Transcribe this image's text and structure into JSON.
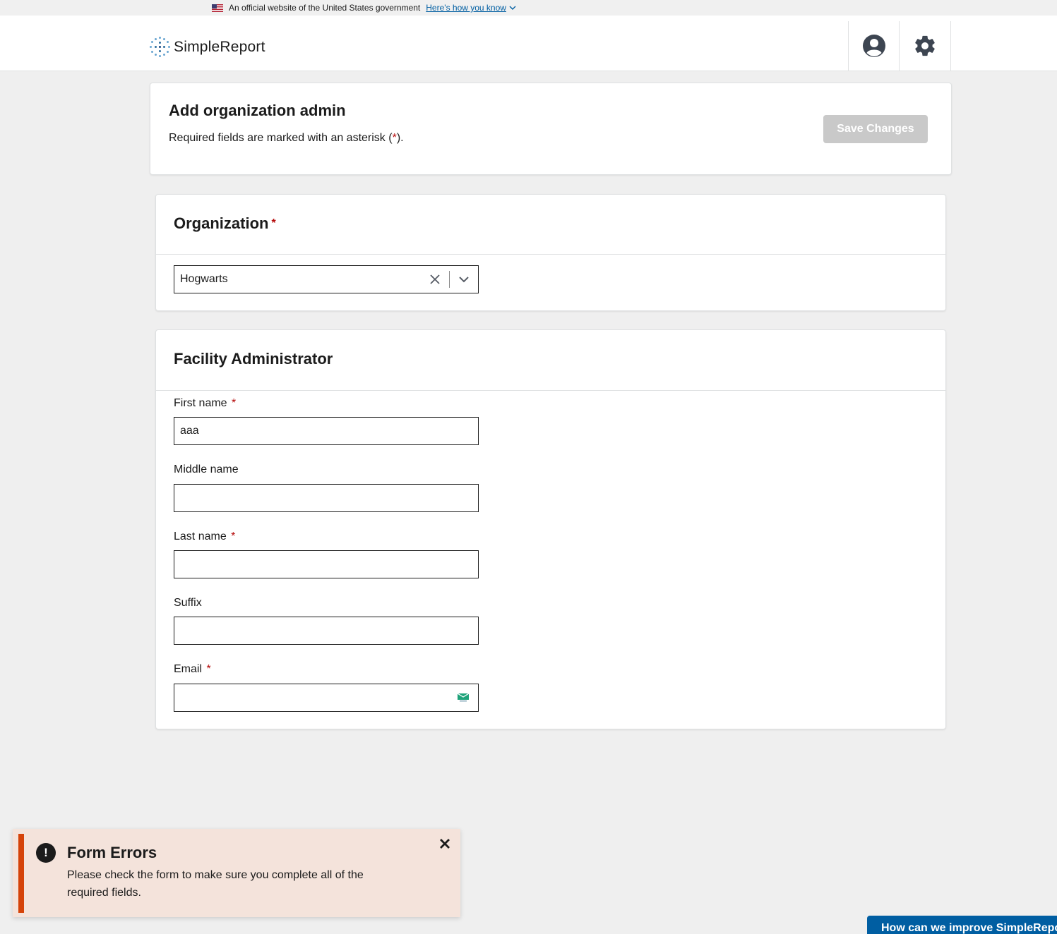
{
  "gov_banner": {
    "text": "An official website of the United States government",
    "link": "Here's how you know"
  },
  "header": {
    "logo_text": "SimpleReport",
    "user_icon": "user-circle-icon",
    "settings_icon": "gear-icon"
  },
  "top_card": {
    "title": "Add organization admin",
    "required_prefix": "Required fields are marked with an asterisk (",
    "required_star": "*",
    "required_suffix": ").",
    "save_label": "Save Changes"
  },
  "organization": {
    "title": "Organization",
    "star": "*",
    "selected_value": "Hogwarts"
  },
  "facility_admin": {
    "title": "Facility Administrator",
    "fields": [
      {
        "label": "First name",
        "required": "*",
        "value": "aaa"
      },
      {
        "label": "Middle name",
        "required": "",
        "value": ""
      },
      {
        "label": "Last name",
        "required": "*",
        "value": ""
      },
      {
        "label": "Suffix",
        "required": "",
        "value": ""
      },
      {
        "label": "Email",
        "required": "*",
        "value": ""
      }
    ]
  },
  "toast": {
    "title": "Form Errors",
    "message": "Please check the form to make sure you complete all of the required fields.",
    "icon": "alert-icon"
  },
  "feedback": {
    "label": "How can we improve SimpleReport?"
  },
  "colors": {
    "accent": "#005ea2",
    "error": "#d54309",
    "required": "#b50909",
    "toast_bg": "#f4e3db"
  }
}
